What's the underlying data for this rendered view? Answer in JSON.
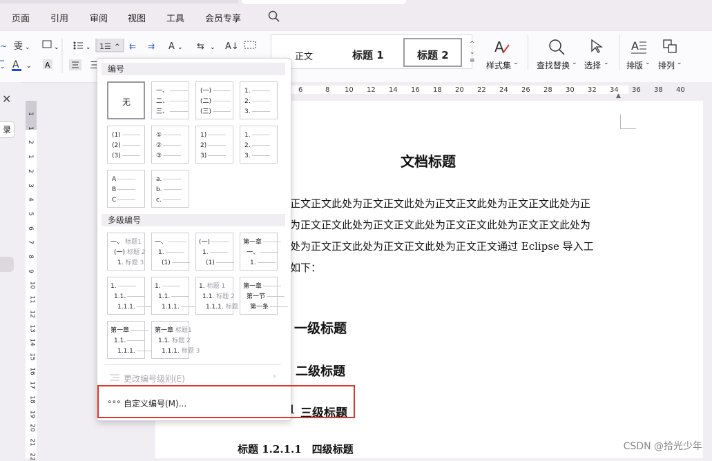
{
  "menubar": {
    "items": [
      "页面",
      "引用",
      "审阅",
      "视图",
      "工具",
      "会员专享"
    ]
  },
  "ribbon": {
    "styles": [
      "正文",
      "标题 1",
      "标题 2"
    ],
    "style_set_label": "样式集",
    "find_replace_label": "查找替换",
    "select_label": "选择",
    "arrange_label": "排版",
    "sort_label": "排列"
  },
  "ruler": {
    "h_ticks": [
      "6",
      "8",
      "10",
      "12",
      "14",
      "16",
      "18",
      "20",
      "22",
      "24",
      "26",
      "28",
      "30",
      "32",
      "34",
      "36",
      "38",
      "40"
    ],
    "v_ticks": [
      "1",
      "1",
      "2",
      "1",
      "2",
      "3",
      "4",
      "5",
      "6",
      "7",
      "8",
      "9",
      "10",
      "11",
      "12",
      "13",
      "14",
      "15",
      "16",
      "17",
      "18",
      "19",
      "20",
      "21",
      "22"
    ]
  },
  "left_pane": {
    "tab_label": "录"
  },
  "document": {
    "title": "文档标题",
    "paragraph_lines": [
      "正文正文此处为正文正文此处为正文正文此处为正文正文此处为正",
      "为正文正文此处为正文正文此处为正文正文此处为正文正文此处为",
      "处为正文正文此处为正文正文此处为正文正文通过 Eclipse 导入工",
      "如下："
    ],
    "h1": "一级标题",
    "h2": "二级标题",
    "h3_prefix": "1",
    "h3": "三级标题",
    "h4": "标题 1.2.1.1　四级标题"
  },
  "dropdown": {
    "section_numbering": "编号",
    "none_label": "无",
    "single_level": [
      [
        [
          "一、"
        ],
        [
          "二、"
        ],
        [
          "三、"
        ]
      ],
      [
        [
          "(一)"
        ],
        [
          "(二)"
        ],
        [
          "(三)"
        ]
      ],
      [
        [
          "1."
        ],
        [
          "2."
        ],
        [
          "3."
        ]
      ],
      [
        [
          "(1)"
        ],
        [
          "(2)"
        ],
        [
          "(3)"
        ]
      ],
      [
        [
          "①"
        ],
        [
          "②"
        ],
        [
          "③"
        ]
      ],
      [
        [
          "1)"
        ],
        [
          "2)"
        ],
        [
          "3)"
        ]
      ],
      [
        [
          "1."
        ],
        [
          "2."
        ],
        [
          "3."
        ]
      ],
      [
        [
          "A"
        ],
        [
          "B"
        ],
        [
          "C"
        ]
      ],
      [
        [
          "a."
        ],
        [
          "b."
        ],
        [
          "c."
        ]
      ]
    ],
    "section_multilevel": "多级编号",
    "multilevel": [
      [
        [
          "一、",
          "标题1"
        ],
        [
          "(一)",
          "标题 2"
        ],
        [
          "1.",
          "标题 3"
        ]
      ],
      [
        [
          "一、",
          ""
        ],
        [
          "1.",
          ""
        ],
        [
          "(1)",
          ""
        ]
      ],
      [
        [
          "(一)",
          ""
        ],
        [
          "1.",
          ""
        ],
        [
          "(1)",
          ""
        ]
      ],
      [
        [
          "第一章",
          ""
        ],
        [
          "一、",
          ""
        ],
        [
          "1.",
          ""
        ]
      ],
      [
        [
          "1.",
          ""
        ],
        [
          "1.1.",
          ""
        ],
        [
          "1.1.1.",
          ""
        ]
      ],
      [
        [
          "1.",
          ""
        ],
        [
          "1.1.",
          ""
        ],
        [
          "1.1.1.",
          ""
        ]
      ],
      [
        [
          "1.",
          "标题 1"
        ],
        [
          "1.1.",
          "标题 2"
        ],
        [
          "1.1.1.",
          "标题 3"
        ]
      ],
      [
        [
          "第一章",
          ""
        ],
        [
          "第一节",
          ""
        ],
        [
          "第一条",
          ""
        ]
      ],
      [
        [
          "第一章",
          ""
        ],
        [
          "1.1.",
          ""
        ],
        [
          "1.1.1.",
          ""
        ]
      ],
      [
        [
          "第一章",
          "标题1"
        ],
        [
          "1.1.",
          "标题 2"
        ],
        [
          "1.1.1.",
          "标题 3"
        ]
      ]
    ],
    "change_level_label": "更改编号级别(E)",
    "custom_label": "自定义编号(M)..."
  },
  "watermark": "CSDN @拾光少年"
}
